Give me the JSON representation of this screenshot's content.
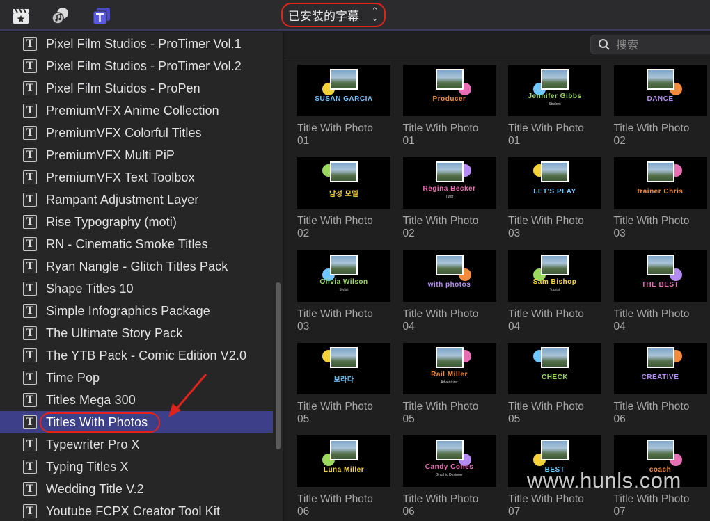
{
  "toolbar": {
    "icons": [
      "clapper-icon",
      "music-photo-icon",
      "titles-icon"
    ],
    "dropdown_label": "已安装的字幕",
    "accent": "#e0241b"
  },
  "sidebar": {
    "items": [
      {
        "label": "Pixel Film Studios - ProTimer Vol.1"
      },
      {
        "label": "Pixel Film Studios - ProTimer Vol.2"
      },
      {
        "label": "Pixel Film Stuidos - ProPen"
      },
      {
        "label": "PremiumVFX Anime Collection"
      },
      {
        "label": "PremiumVFX Colorful Titles"
      },
      {
        "label": "PremiumVFX Multi PiP"
      },
      {
        "label": "PremiumVFX Text Toolbox"
      },
      {
        "label": "Rampant Adjustment Layer"
      },
      {
        "label": "Rise Typography (moti)"
      },
      {
        "label": "RN - Cinematic Smoke Titles"
      },
      {
        "label": "Ryan Nangle - Glitch Titles Pack"
      },
      {
        "label": "Shape Titles 10"
      },
      {
        "label": "Simple Infographics Package"
      },
      {
        "label": "The Ultimate Story Pack"
      },
      {
        "label": "The YTB Pack - Comic Edition V2.0"
      },
      {
        "label": "Time Pop"
      },
      {
        "label": "Titles Mega 300"
      },
      {
        "label": "Titles With Photos"
      },
      {
        "label": "Typewriter Pro X"
      },
      {
        "label": "Typing Titles X"
      },
      {
        "label": "Wedding Title V.2"
      },
      {
        "label": "Youtube FCPX Creator Tool Kit"
      }
    ],
    "selected_index": 17,
    "selected_color": "#3d3f88"
  },
  "search": {
    "placeholder": "搜索"
  },
  "tiles": [
    {
      "title": "Title With Photo",
      "number": "01",
      "caption": "SUSAN GARCIA"
    },
    {
      "title": "Title With Photo",
      "number": "01",
      "caption": "Producer"
    },
    {
      "title": "Title With Photo",
      "number": "01",
      "caption": "Jennifer Gibbs",
      "sub": "Student"
    },
    {
      "title": "Title With Photo",
      "number": "02",
      "caption": "DANCE"
    },
    {
      "title": "Title With Photo",
      "number": "02",
      "caption": "남성 모델"
    },
    {
      "title": "Title With Photo",
      "number": "02",
      "caption": "Regina Becker",
      "sub": "Tutor"
    },
    {
      "title": "Title With Photo",
      "number": "03",
      "caption": "LET'S PLAY"
    },
    {
      "title": "Title With Photo",
      "number": "03",
      "caption": "trainer Chris"
    },
    {
      "title": "Title With Photo",
      "number": "03",
      "caption": "Olivia Wilson",
      "sub": "Stylist"
    },
    {
      "title": "Title With Photo",
      "number": "04",
      "caption": "with photos"
    },
    {
      "title": "Title With Photo",
      "number": "04",
      "caption": "Sam Bishop",
      "sub": "Tourist"
    },
    {
      "title": "Title With Photo",
      "number": "04",
      "caption": "THE BEST"
    },
    {
      "title": "Title With Photo",
      "number": "05",
      "caption": "보라다"
    },
    {
      "title": "Title With Photo",
      "number": "05",
      "caption": "Rail Miller",
      "sub": "Adventurer"
    },
    {
      "title": "Title With Photo",
      "number": "05",
      "caption": "CHECK"
    },
    {
      "title": "Title With Photo",
      "number": "06",
      "caption": "CREATIVE"
    },
    {
      "title": "Title With Photo",
      "number": "06",
      "caption": "Luna Miller"
    },
    {
      "title": "Title With Photo",
      "number": "06",
      "caption": "Candy Cones",
      "sub": "Graphic Designer"
    },
    {
      "title": "Title With Photo",
      "number": "07",
      "caption": "BEST"
    },
    {
      "title": "Title With Photo",
      "number": "07",
      "caption": "coach"
    }
  ],
  "watermark": "www.hunls.com"
}
